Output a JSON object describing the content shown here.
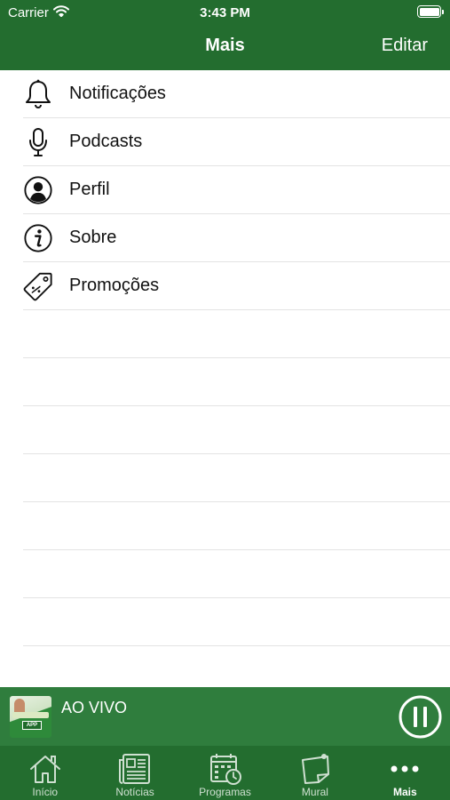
{
  "status_bar": {
    "carrier": "Carrier",
    "time": "3:43 PM"
  },
  "nav": {
    "title": "Mais",
    "edit_label": "Editar"
  },
  "menu": {
    "items": [
      {
        "label": "Notificações",
        "icon": "bell-icon"
      },
      {
        "label": "Podcasts",
        "icon": "microphone-icon"
      },
      {
        "label": "Perfil",
        "icon": "profile-icon"
      },
      {
        "label": "Sobre",
        "icon": "info-icon"
      },
      {
        "label": "Promoções",
        "icon": "tag-icon"
      }
    ]
  },
  "player": {
    "title": "AO VIVO",
    "artwork_badge": "APP",
    "state": "playing"
  },
  "tabs": [
    {
      "label": "Início",
      "icon": "home-icon",
      "active": false
    },
    {
      "label": "Notícias",
      "icon": "newspaper-icon",
      "active": false
    },
    {
      "label": "Programas",
      "icon": "calendar-clock-icon",
      "active": false
    },
    {
      "label": "Mural",
      "icon": "note-pin-icon",
      "active": false
    },
    {
      "label": "Mais",
      "icon": "more-dots-icon",
      "active": true
    }
  ],
  "colors": {
    "header_green": "#236d2f",
    "player_green": "#2f7d3d",
    "separator": "#e3e3e3",
    "text": "#111111"
  }
}
